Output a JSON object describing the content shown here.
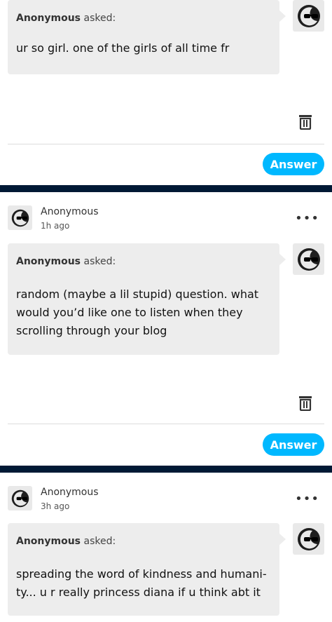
{
  "posts": [
    {
      "asked_by": "Anonymous",
      "asked_suffix": "asked:",
      "question": "ur so girl. one of the girls of all time fr",
      "answer_label": "Answer",
      "avatar_icon": "sunglasses-face-icon"
    },
    {
      "author": "Anonymous",
      "time": "1h ago",
      "more": "•••",
      "asked_by": "Anonymous",
      "asked_suffix": "asked:",
      "question": "random (maybe a lil stupid) question. what would you’d like one to listen when they scrolling through your blog",
      "answer_label": "Answer",
      "avatar_icon": "sunglasses-face-icon"
    },
    {
      "author": "Anonymous",
      "time": "3h ago",
      "more": "•••",
      "asked_by": "Anonymous",
      "asked_suffix": "asked:",
      "question": "spreading the word of kindness and humani- ty... u r really princess diana if u think abt it",
      "avatar_icon": "sunglasses-face-icon"
    }
  ],
  "colors": {
    "accent": "#00b8ff",
    "separator": "#001935",
    "bubble": "#ededed"
  }
}
